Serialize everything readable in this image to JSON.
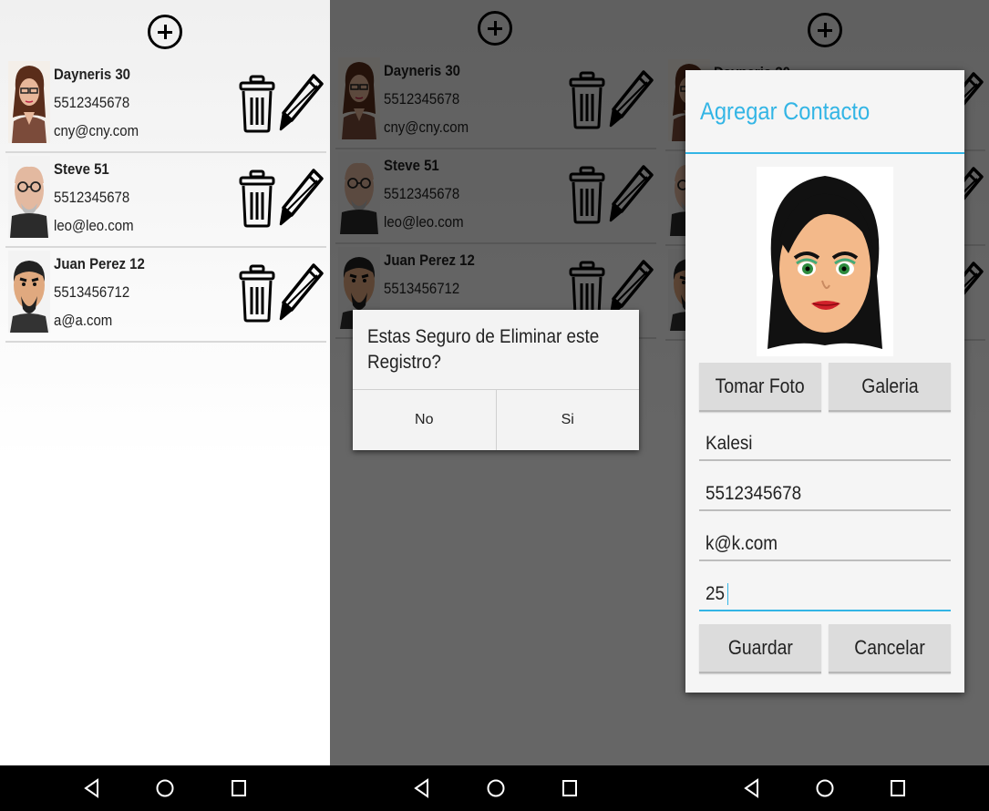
{
  "contacts": [
    {
      "name": "Dayneris 30",
      "phone": "5512345678",
      "email": "cny@cny.com",
      "avatar": "woman-glasses-avatar"
    },
    {
      "name": "Steve 51",
      "phone": "5512345678",
      "email": "leo@leo.com",
      "avatar": "old-man-glasses-avatar"
    },
    {
      "name": "Juan Perez 12",
      "phone": "5513456712",
      "email": "a@a.com",
      "avatar": "bald-man-avatar"
    }
  ],
  "icons": {
    "add": "plus-circle-icon",
    "delete": "trash-icon",
    "edit": "pencil-icon"
  },
  "confirm_dialog": {
    "message": "Estas Seguro de Eliminar este Registro?",
    "no_label": "No",
    "yes_label": "Si"
  },
  "add_dialog": {
    "title": "Agregar Contacto",
    "photo": "cartoon-woman-avatar",
    "take_photo_label": "Tomar Foto",
    "gallery_label": "Galeria",
    "name_value": "Kalesi",
    "phone_value": "5512345678",
    "email_value": "k@k.com",
    "age_value": "25",
    "save_label": "Guardar",
    "cancel_label": "Cancelar"
  },
  "colors": {
    "accent": "#33b5e5",
    "dim_overlay": "rgba(0,0,0,0.6)",
    "navbar": "#000000"
  },
  "navbar": {
    "back": "back-icon",
    "home": "home-icon",
    "recents": "recents-icon"
  }
}
